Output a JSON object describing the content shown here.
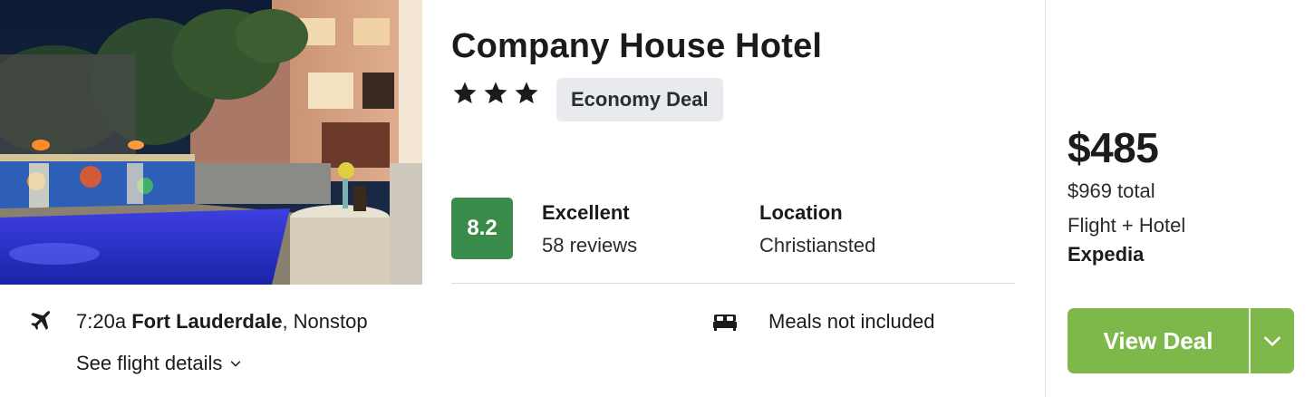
{
  "hotel": {
    "name": "Company House Hotel",
    "star_rating": 3,
    "deal_badge": "Economy Deal",
    "photo_icon": "hotel-pool-photo"
  },
  "rating": {
    "score": "8.2",
    "label": "Excellent",
    "reviews": "58 reviews",
    "score_color": "#3a8a4a"
  },
  "location": {
    "label": "Location",
    "value": "Christiansted"
  },
  "flight": {
    "icon": "airplane-icon",
    "time": "7:20a",
    "origin": "Fort Lauderdale",
    "stops": ", Nonstop",
    "details_link": "See flight details"
  },
  "amenities": {
    "icon": "bed-icon",
    "meals": "Meals not included"
  },
  "pricing": {
    "price": "$485",
    "total": "$969 total",
    "package": "Flight + Hotel",
    "provider": "Expedia"
  },
  "cta": {
    "label": "View Deal",
    "color": "#7eb84a"
  }
}
